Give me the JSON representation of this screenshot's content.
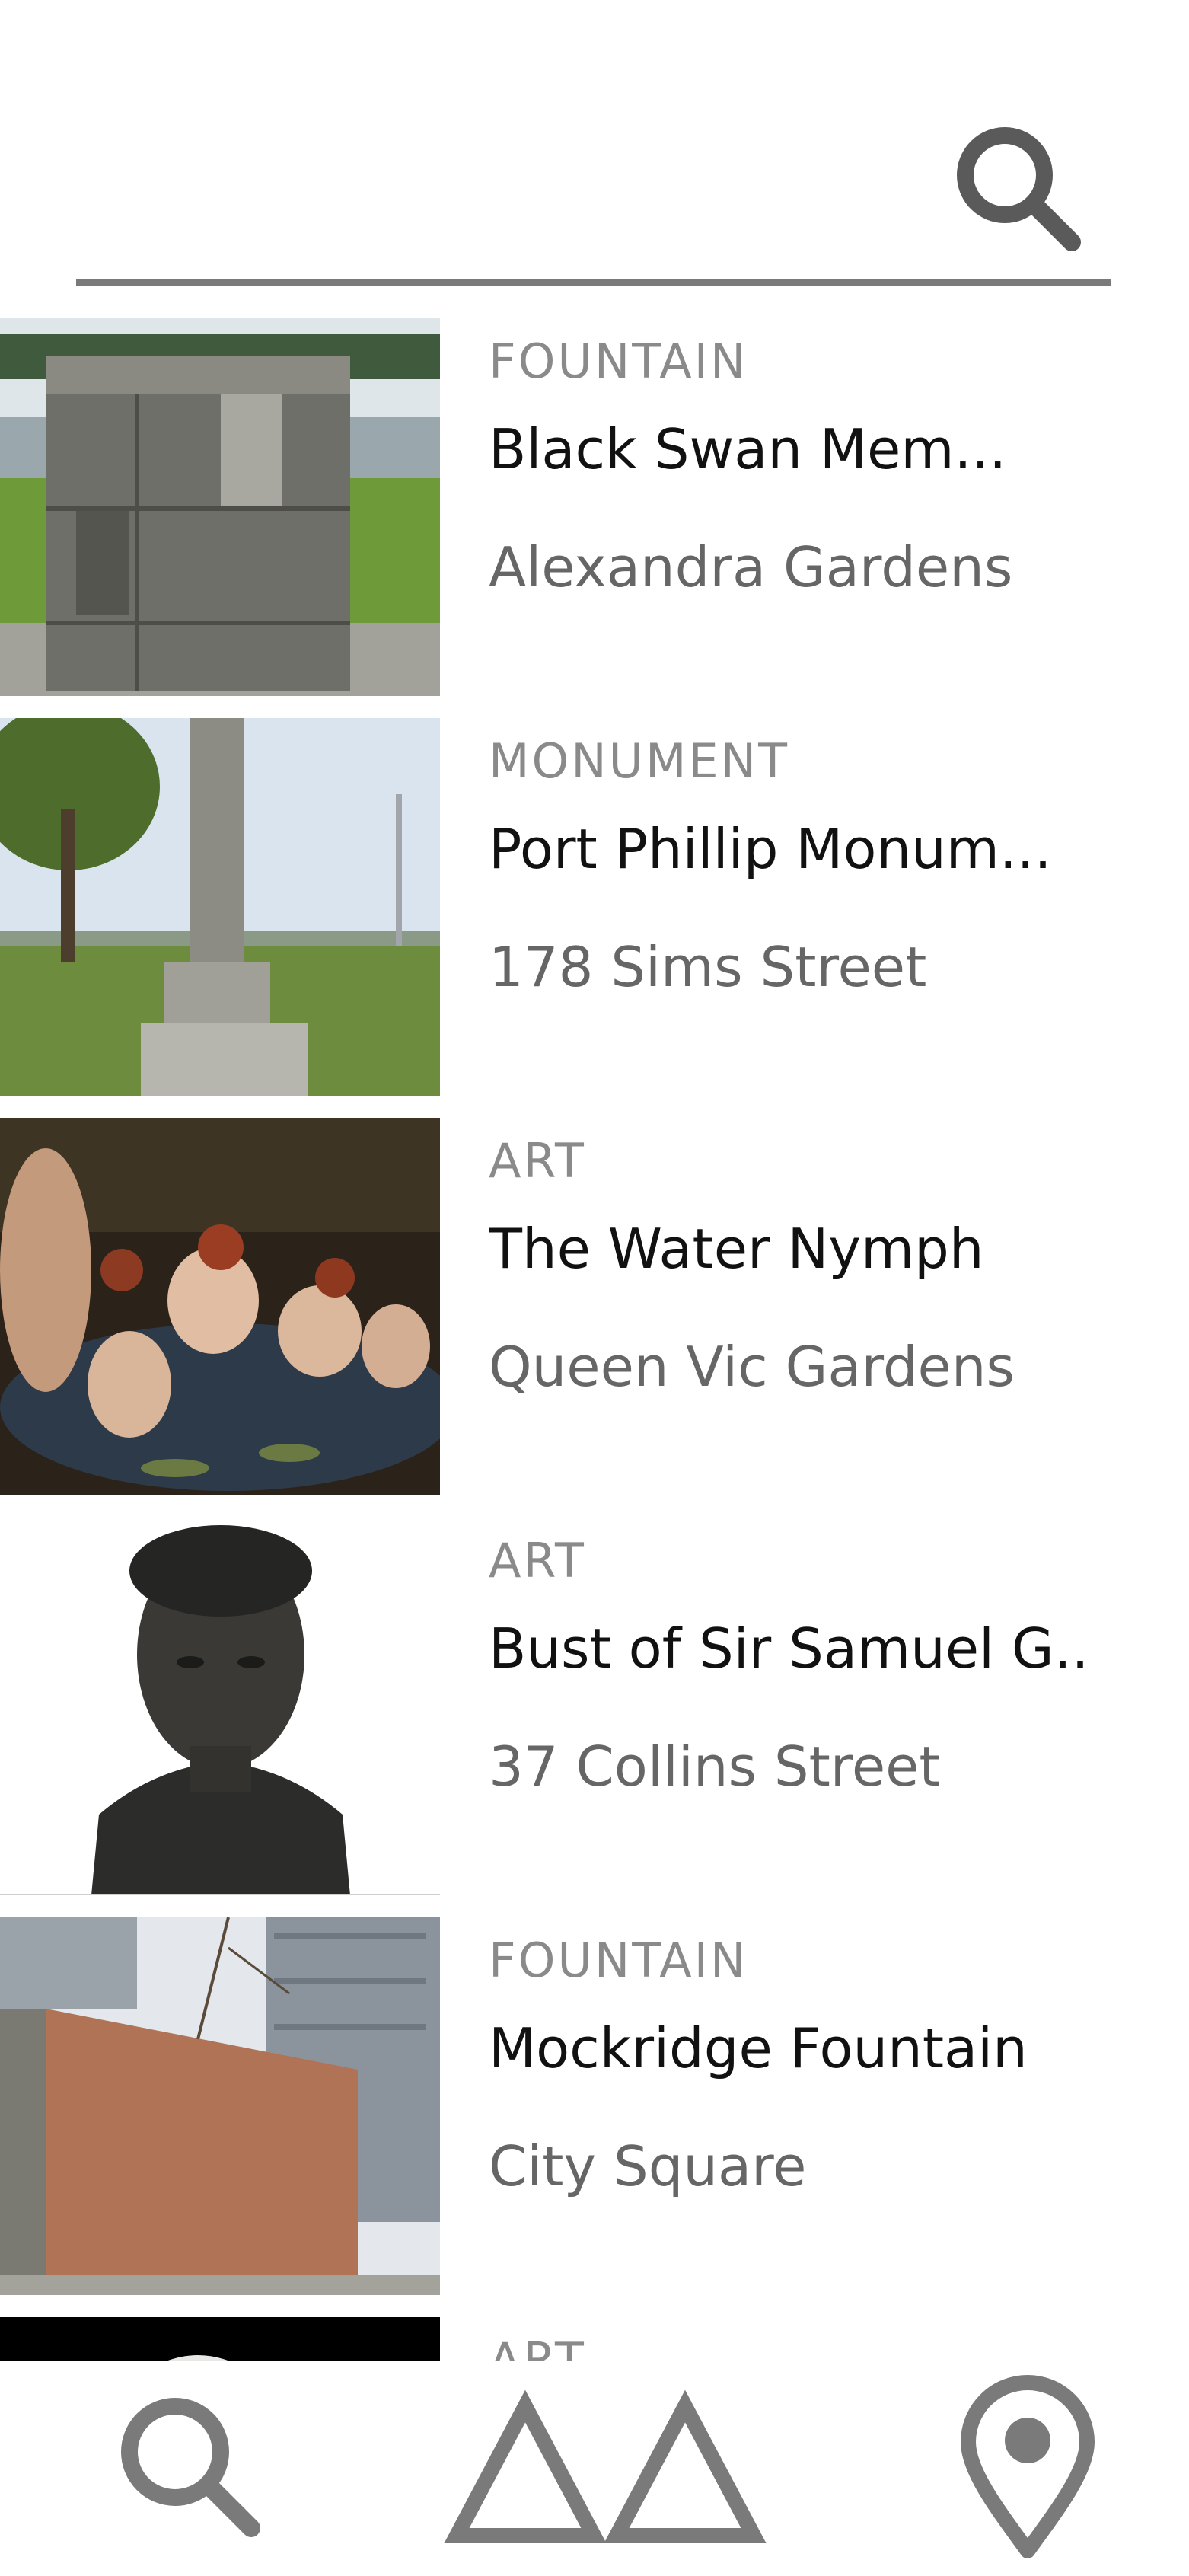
{
  "search": {
    "placeholder": "",
    "value": "",
    "icon": "search-icon"
  },
  "results": [
    {
      "category": "FOUNTAIN",
      "name": "Black Swan Mem...",
      "location": "Alexandra Gardens",
      "image": "stone-pedestal-photo"
    },
    {
      "category": "MONUMENT",
      "name": "Port Phillip Monum...",
      "location": "178 Sims Street",
      "image": "obelisk-photo"
    },
    {
      "category": "ART",
      "name": "The Water Nymph",
      "location": "Queen Vic Gardens",
      "image": "painting-photo"
    },
    {
      "category": "ART",
      "name": "Bust of Sir Samuel G..",
      "location": "37 Collins Street",
      "image": "bronze-bust-photo"
    },
    {
      "category": "FOUNTAIN",
      "name": "Mockridge Fountain",
      "location": "City Square",
      "image": "fountain-wall-photo"
    },
    {
      "category": "ART",
      "name": "",
      "location": "",
      "image": "sculpture-photo"
    }
  ],
  "nav": {
    "items": [
      {
        "icon": "search-icon"
      },
      {
        "icon": "monuments-icon"
      },
      {
        "icon": "map-pin-icon"
      }
    ]
  },
  "colors": {
    "icon": "#5a5a5a",
    "divider": "#7a7a7a",
    "category": "#8a8a8a",
    "title": "#111111",
    "location": "#666666"
  }
}
